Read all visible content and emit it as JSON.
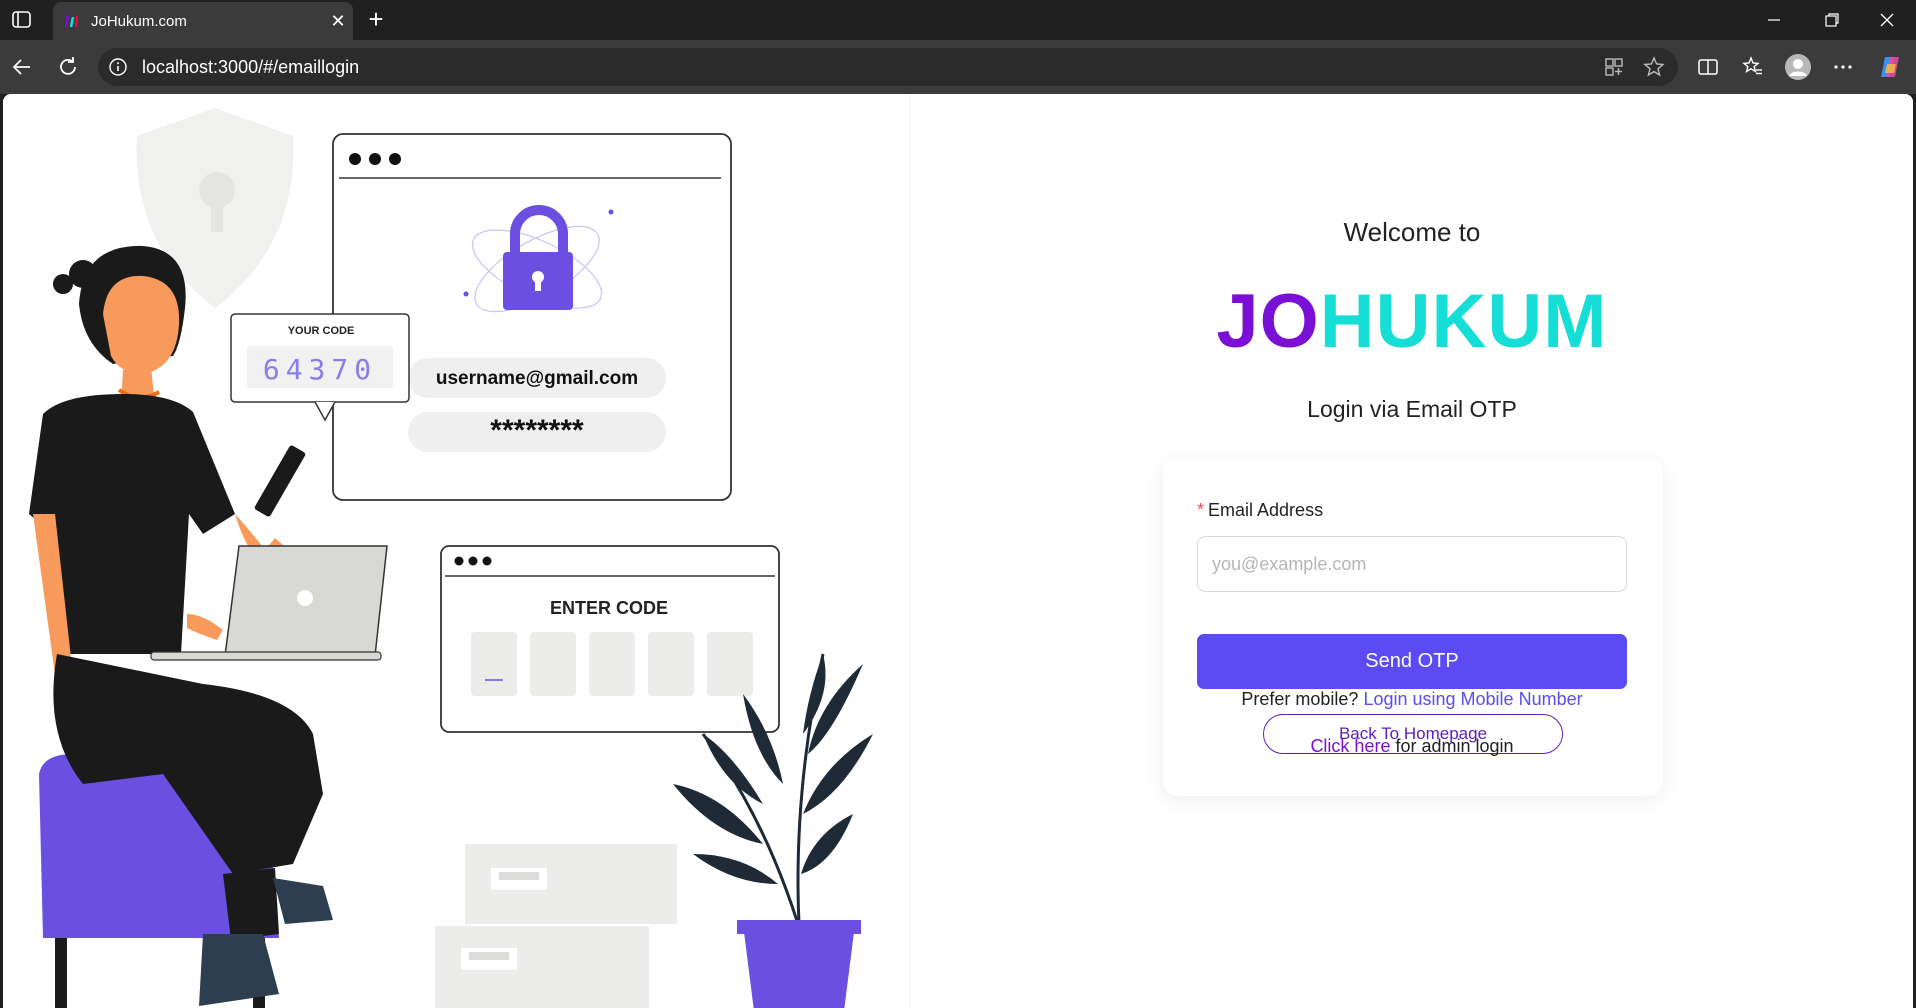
{
  "browser": {
    "tab_title": "JoHukum.com",
    "url": "localhost:3000/#/emaillogin"
  },
  "page": {
    "welcome": "Welcome to",
    "brand_part1": "JO",
    "brand_part2": "HUKUM",
    "subtitle": "Login via Email OTP",
    "form": {
      "email_label": "Email Address",
      "email_placeholder": "you@example.com",
      "email_value": "",
      "send_button": "Send OTP",
      "back_button": "Back To Homepage"
    },
    "mobile_prompt": "Prefer mobile?",
    "mobile_link": "Login using Mobile Number",
    "admin_link": "Click here",
    "admin_text": "for admin login"
  },
  "illustration": {
    "code_bubble_title": "YOUR CODE",
    "code_value": "64370",
    "username_field": "username@gmail.com",
    "password_field": "********",
    "enter_code_title": "ENTER CODE"
  },
  "colors": {
    "brand_purple": "#7a0fd6",
    "brand_teal": "#14ded6",
    "primary_button": "#5b4bf5",
    "illustration_purple": "#6a4fe0"
  }
}
